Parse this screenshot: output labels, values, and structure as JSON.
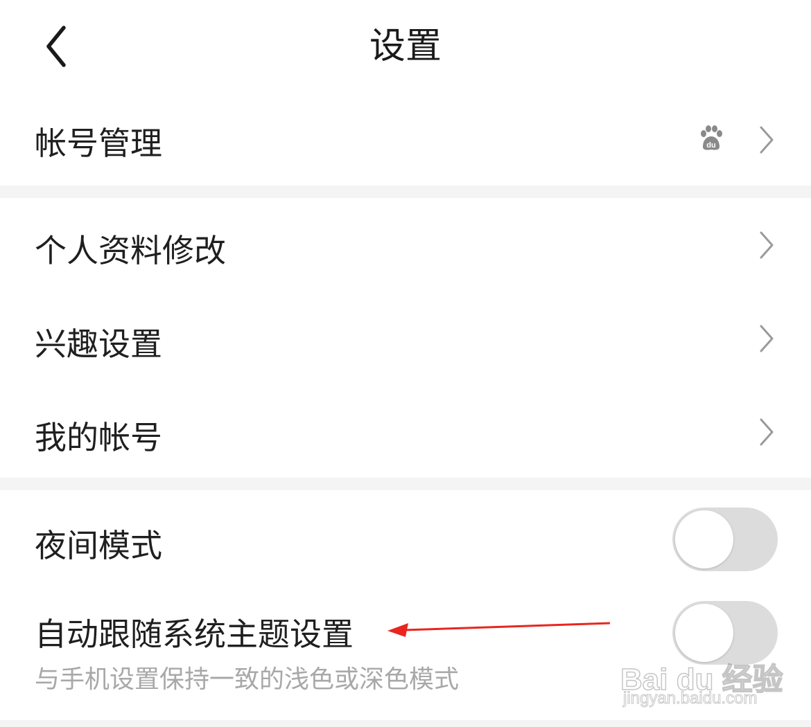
{
  "header": {
    "title": "设置"
  },
  "groups": [
    {
      "items": [
        {
          "label": "帐号管理",
          "trailing_icon": "baidu-paw-icon",
          "chevron": true
        }
      ]
    },
    {
      "items": [
        {
          "label": "个人资料修改",
          "chevron": true
        },
        {
          "label": "兴趣设置",
          "chevron": true
        },
        {
          "label": "我的帐号",
          "chevron": true
        }
      ]
    },
    {
      "items": [
        {
          "label": "夜间模式",
          "toggle": false
        },
        {
          "label": "自动跟随系统主题设置",
          "description": "与手机设置保持一致的浅色或深色模式",
          "toggle": false
        }
      ]
    }
  ],
  "annotation": {
    "type": "red-arrow",
    "color": "#e8261f",
    "points_to": "自动跟随系统主题设置"
  },
  "watermark": {
    "brand": "Bai du 经验",
    "url": "jingyan.baidu.com"
  },
  "colors": {
    "background": "#ffffff",
    "separator": "#f4f4f4",
    "text_primary": "#1f1f1f",
    "text_secondary": "#a8a8a8",
    "chevron": "#9a9a9a",
    "toggle_off_track": "#dcdcdc",
    "toggle_knob": "#ffffff"
  }
}
